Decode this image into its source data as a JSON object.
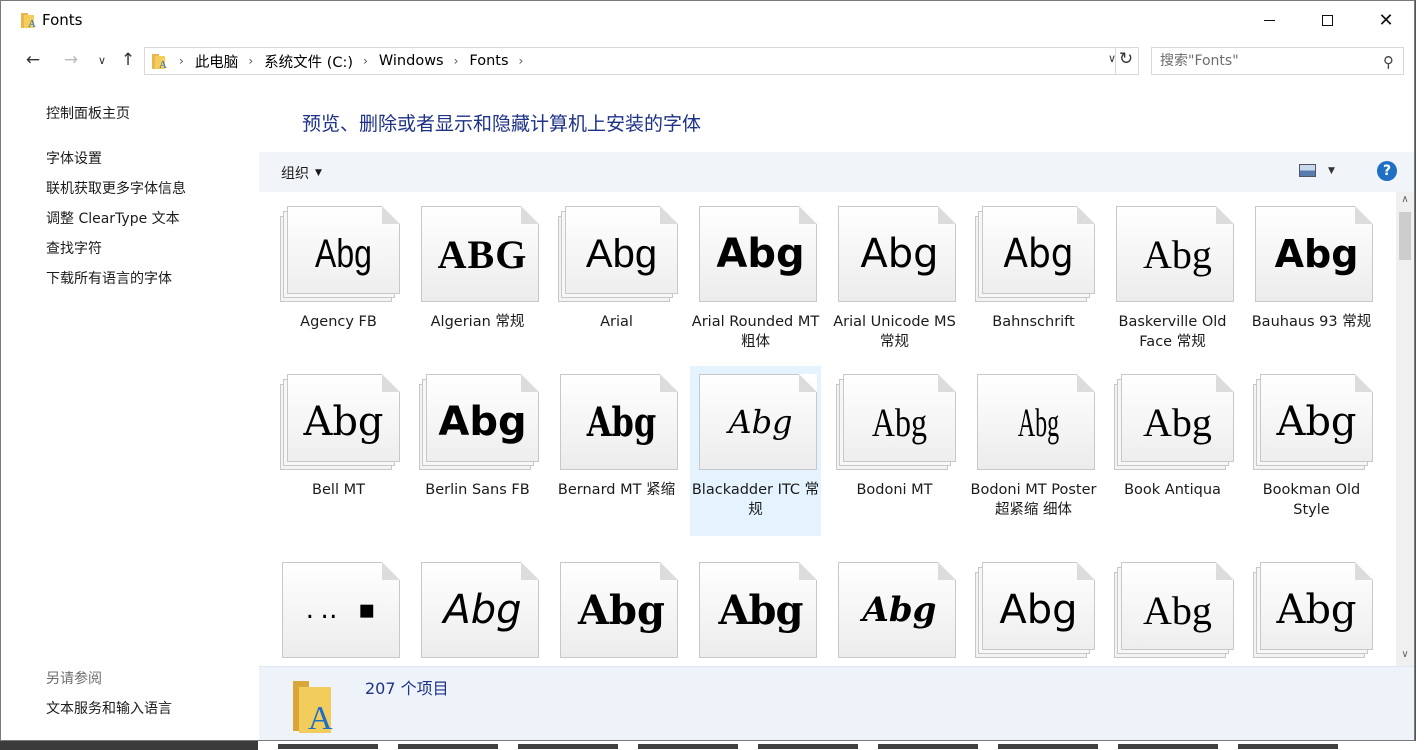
{
  "window": {
    "title": "Fonts"
  },
  "nav": {
    "breadcrumbs": [
      "此电脑",
      "系统文件 (C:)",
      "Windows",
      "Fonts"
    ],
    "search_placeholder": "搜索\"Fonts\""
  },
  "sidebar": {
    "home": "控制面板主页",
    "links": [
      "字体设置",
      "联机获取更多字体信息",
      "调整 ClearType 文本",
      "查找字符",
      "下载所有语言的字体"
    ],
    "see_also_title": "另请参阅",
    "see_also_links": [
      "文本服务和输入语言"
    ]
  },
  "main": {
    "heading": "预览、删除或者显示和隐藏计算机上安装的字体",
    "organize": "组织",
    "help": "?"
  },
  "fonts": [
    {
      "name": "Agency FB",
      "sample": "Abg",
      "family": "family"
    },
    {
      "name": "Algerian 常规",
      "sample": "ABG",
      "family": "single"
    },
    {
      "name": "Arial",
      "sample": "Abg",
      "family": "family"
    },
    {
      "name": "Arial Rounded MT 粗体",
      "sample": "Abg",
      "family": "single"
    },
    {
      "name": "Arial Unicode MS 常规",
      "sample": "Abg",
      "family": "single"
    },
    {
      "name": "Bahnschrift",
      "sample": "Abg",
      "family": "family"
    },
    {
      "name": "Baskerville Old Face 常规",
      "sample": "Abg",
      "family": "single"
    },
    {
      "name": "Bauhaus 93 常规",
      "sample": "Abg",
      "family": "single"
    },
    {
      "name": "Bell MT",
      "sample": "Abg",
      "family": "family"
    },
    {
      "name": "Berlin Sans FB",
      "sample": "Abg",
      "family": "family"
    },
    {
      "name": "Bernard MT 紧缩",
      "sample": "Abg",
      "family": "single"
    },
    {
      "name": "Blackadder ITC 常规",
      "sample": "Abg",
      "family": "single",
      "selected": true
    },
    {
      "name": "Bodoni MT",
      "sample": "Abg",
      "family": "family"
    },
    {
      "name": "Bodoni MT Poster 超紧缩 细体",
      "sample": "Abg",
      "family": "single"
    },
    {
      "name": "Book Antiqua",
      "sample": "Abg",
      "family": "family"
    },
    {
      "name": "Bookman Old Style",
      "sample": "Abg",
      "family": "family"
    },
    {
      "name": "",
      "sample": "․‥ ▪",
      "family": "single"
    },
    {
      "name": "",
      "sample": "Abg",
      "family": "single"
    },
    {
      "name": "",
      "sample": "Abg",
      "family": "single"
    },
    {
      "name": "",
      "sample": "Abg",
      "family": "single"
    },
    {
      "name": "",
      "sample": "Abg",
      "family": "single"
    },
    {
      "name": "",
      "sample": "Abg",
      "family": "family"
    },
    {
      "name": "",
      "sample": "Abg",
      "family": "family"
    },
    {
      "name": "",
      "sample": "Abg",
      "family": "family"
    }
  ],
  "status": {
    "count": "207 个项目"
  }
}
